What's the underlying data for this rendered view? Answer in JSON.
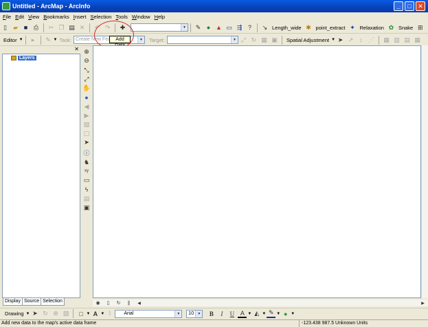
{
  "window": {
    "title": "Untitled - ArcMap - ArcInfo"
  },
  "menu": [
    "File",
    "Edit",
    "View",
    "Bookmarks",
    "Insert",
    "Selection",
    "Tools",
    "Window",
    "Help"
  ],
  "standard_toolbar": {
    "tool_labels": [
      "Length_wide",
      "point_extract",
      "Relaxation",
      "Snake"
    ],
    "scale_value": ""
  },
  "editor_toolbar": {
    "editor_label": "Editor",
    "task_label": "Task:",
    "task_value": "Create New Feature",
    "target_label": "Target:",
    "target_value": "",
    "spatial_adjustment": "Spatial Adjustment"
  },
  "tooltip": "Add Data",
  "toc": {
    "root_layer": "Layers",
    "tabs": [
      "Display",
      "Source",
      "Selection"
    ]
  },
  "drawing_toolbar": {
    "drawing_label": "Drawing",
    "font_name": "Arial",
    "font_size": "10",
    "bold": "B",
    "italic": "I",
    "underline": "U",
    "font_color": "A"
  },
  "status": {
    "message": "Add new data to the map's active data frame",
    "coordinates": "-123.438  987.5 Unknown Units"
  },
  "colors": {
    "titlebar": "#0a5ae6",
    "highlight_circle": "#d32a2a",
    "selection": "#316ac5"
  }
}
